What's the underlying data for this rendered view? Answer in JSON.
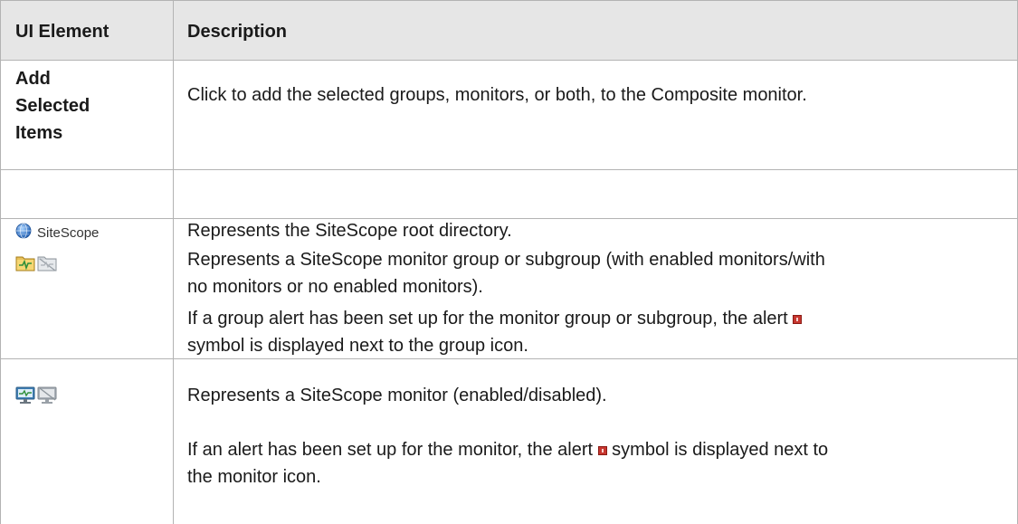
{
  "header": {
    "col1": "UI Element",
    "col2": "Description"
  },
  "rows": [
    {
      "element": "Add Selected Items",
      "element_lines": [
        "Add",
        "Selected",
        "Items"
      ],
      "desc": [
        "Click to add the selected groups, monitors, or both, to the Composite monitor."
      ]
    },
    {
      "element_label": "SiteScope",
      "element_icon": "globe-icon",
      "desc": [
        "Represents the SiteScope root directory."
      ]
    },
    {
      "element_icons": [
        "group-folder-enabled-icon",
        "group-folder-disabled-icon"
      ],
      "desc": [
        "Represents a SiteScope monitor group or subgroup (with enabled monitors/with",
        "no monitors or no enabled monitors)."
      ],
      "desc2_before": "If a group alert has been set up for the monitor group or subgroup, the alert",
      "desc2_after": "symbol is displayed next to the group icon.",
      "alert_icon": "alert-icon"
    },
    {
      "element_icons": [
        "monitor-enabled-icon",
        "monitor-disabled-icon"
      ],
      "desc": [
        "Represents a SiteScope monitor (enabled/disabled)."
      ],
      "desc2_before": "If an alert has been set up for the monitor, the alert",
      "desc2_after": "symbol is displayed next to",
      "desc2_line2": "the monitor icon.",
      "alert_icon": "alert-icon"
    }
  ],
  "colors": {
    "header_bg": "#e6e6e6",
    "grid": "#b3b3b3",
    "alert": "#c7362f"
  }
}
